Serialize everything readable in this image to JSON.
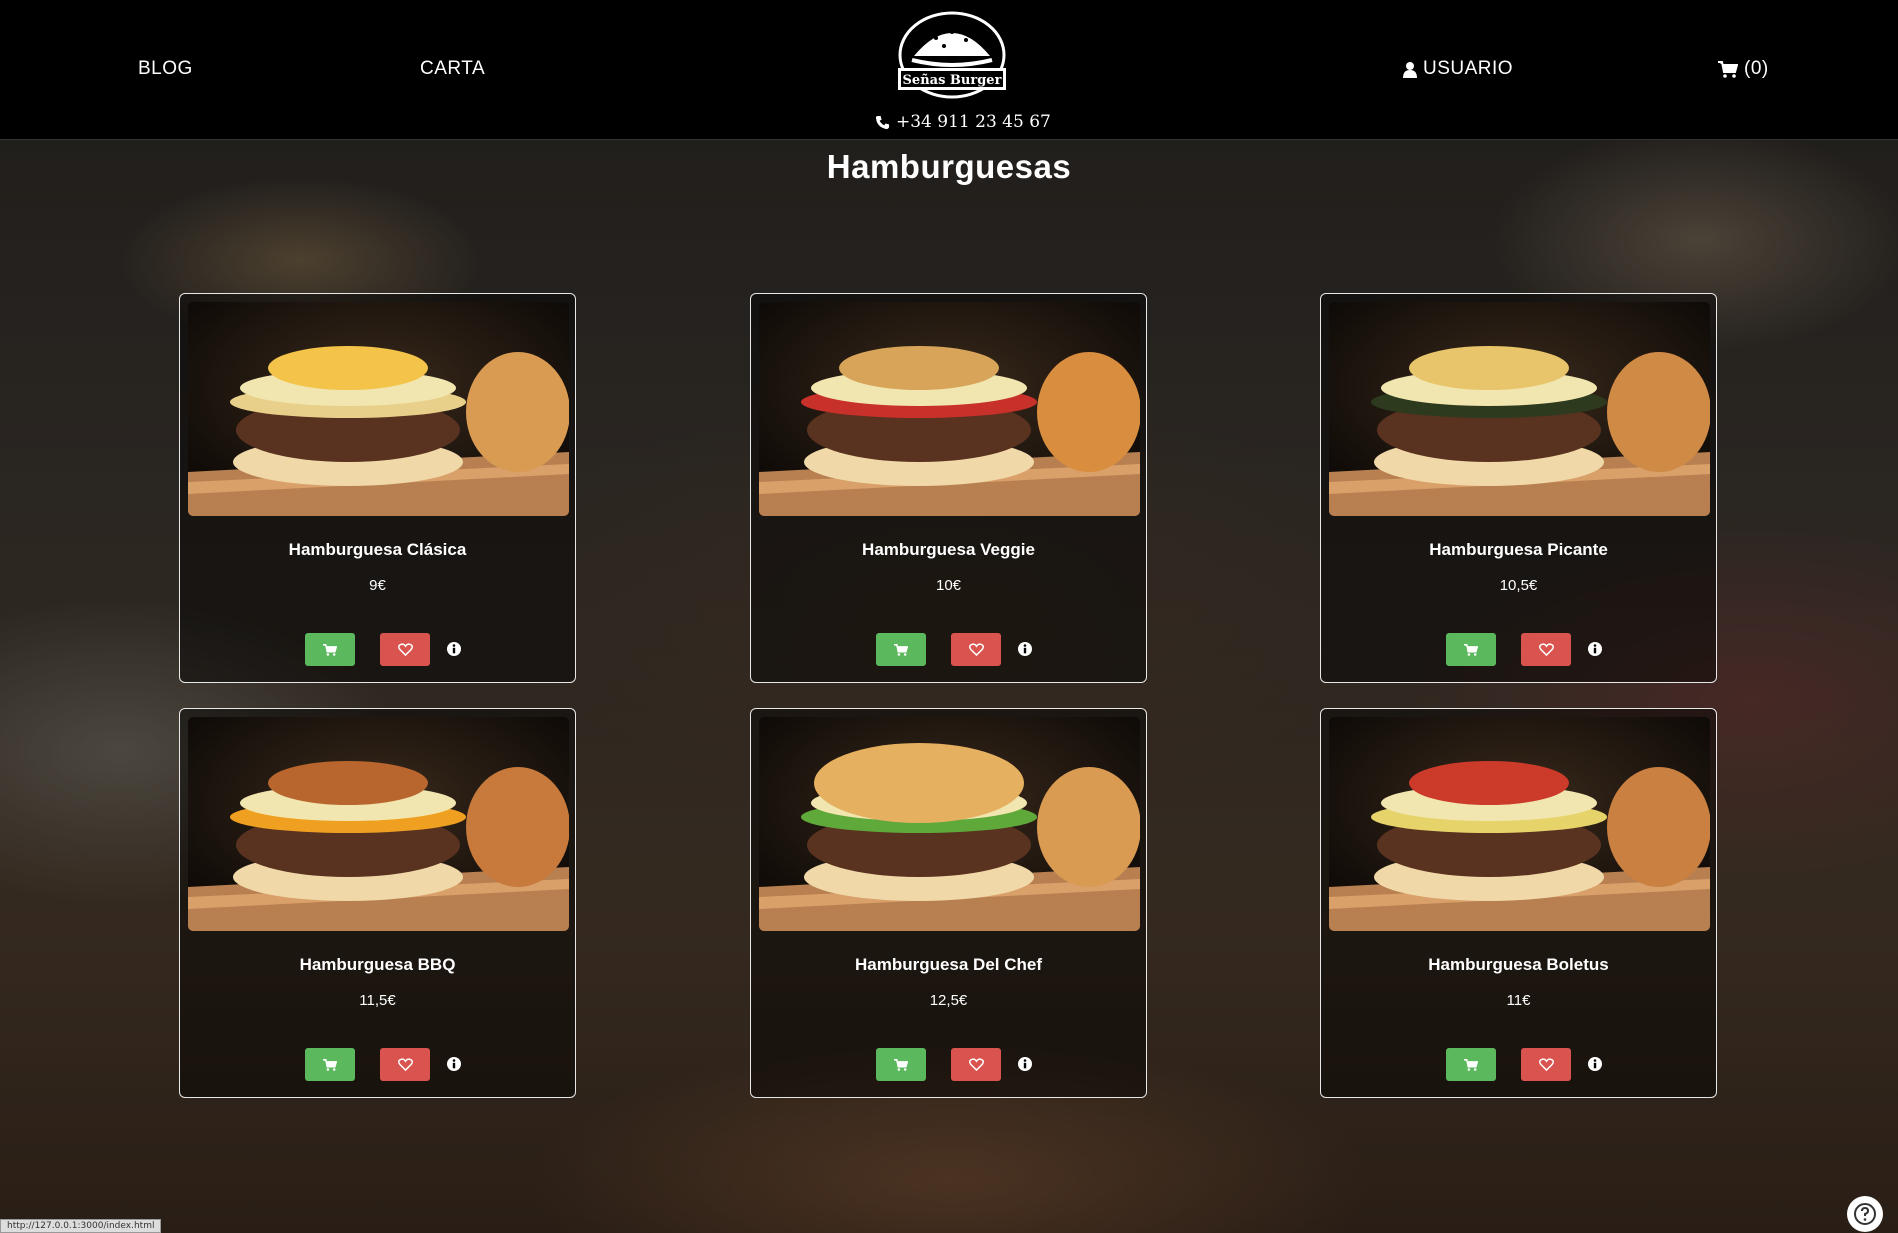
{
  "nav": {
    "blog": "BLOG",
    "carta": "CARTA",
    "usuario": "USUARIO",
    "cart": "(0)",
    "phone": "+34 911 23 45 67",
    "logo_text": "Señas Burger"
  },
  "page": {
    "title": "Hamburguesas"
  },
  "products": [
    {
      "name": "Hamburguesa Clásica",
      "price": "9€"
    },
    {
      "name": "Hamburguesa Veggie",
      "price": "10€"
    },
    {
      "name": "Hamburguesa Picante",
      "price": "10,5€"
    },
    {
      "name": "Hamburguesa BBQ",
      "price": "11,5€"
    },
    {
      "name": "Hamburguesa Del Chef",
      "price": "12,5€"
    },
    {
      "name": "Hamburguesa Boletus",
      "price": "11€"
    }
  ],
  "status_bar": {
    "url": "http://127.0.0.1:3000/index.html"
  },
  "colors": {
    "cart_button": "#5cb85c",
    "fav_button": "#d9534f",
    "navbar": "#000000"
  },
  "icons": [
    "phone-icon",
    "user-icon",
    "cart-icon",
    "heart-icon",
    "info-icon",
    "help-icon"
  ]
}
